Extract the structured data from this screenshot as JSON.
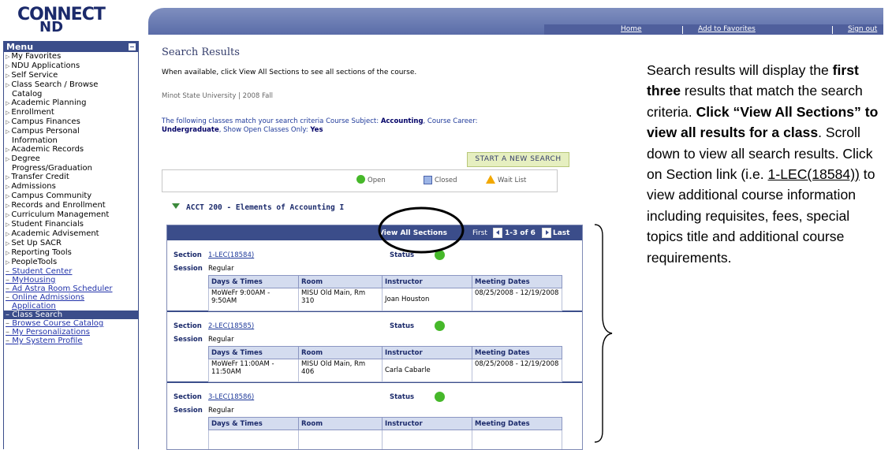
{
  "brand": {
    "logo_text": "CONNECT",
    "logo_sub": "ND"
  },
  "topnav": {
    "home": "Home",
    "favorites": "Add to Favorites",
    "signout": "Sign out"
  },
  "menu": {
    "title": "Menu",
    "items": [
      {
        "label": "My Favorites",
        "type": "folder"
      },
      {
        "label": "NDU Applications",
        "type": "folder"
      },
      {
        "label": "Self Service",
        "type": "folder"
      },
      {
        "label": "Class Search / Browse",
        "type": "folder"
      },
      {
        "label": "Catalog",
        "type": "cont"
      },
      {
        "label": "Academic Planning",
        "type": "folder"
      },
      {
        "label": "Enrollment",
        "type": "folder"
      },
      {
        "label": "Campus Finances",
        "type": "folder"
      },
      {
        "label": "Campus Personal",
        "type": "folder"
      },
      {
        "label": "Information",
        "type": "cont"
      },
      {
        "label": "Academic Records",
        "type": "folder"
      },
      {
        "label": "Degree",
        "type": "folder"
      },
      {
        "label": "Progress/Graduation",
        "type": "cont"
      },
      {
        "label": "Transfer Credit",
        "type": "folder"
      },
      {
        "label": "Admissions",
        "type": "folder"
      },
      {
        "label": "Campus Community",
        "type": "folder"
      },
      {
        "label": "Records and Enrollment",
        "type": "folder"
      },
      {
        "label": "Curriculum Management",
        "type": "folder"
      },
      {
        "label": "Student Financials",
        "type": "folder"
      },
      {
        "label": "Academic Advisement",
        "type": "folder"
      },
      {
        "label": "Set Up SACR",
        "type": "folder"
      },
      {
        "label": "Reporting Tools",
        "type": "folder"
      },
      {
        "label": "PeopleTools",
        "type": "folder"
      },
      {
        "label": "Student Center",
        "type": "link"
      },
      {
        "label": "MyHousing",
        "type": "link"
      },
      {
        "label": "Ad Astra Room Scheduler",
        "type": "link"
      },
      {
        "label": "Online Admissions",
        "type": "link"
      },
      {
        "label": "Application",
        "type": "linkcont"
      },
      {
        "label": "Class Search",
        "type": "active"
      },
      {
        "label": "Browse Course Catalog",
        "type": "link"
      },
      {
        "label": "My Personalizations",
        "type": "link"
      },
      {
        "label": "My System Profile",
        "type": "link"
      }
    ]
  },
  "main": {
    "title": "Search Results",
    "instruction": "When available, click View All Sections to see all sections of the course.",
    "term": "Minot State University | 2008 Fall",
    "criteria_prefix": "The following classes match your search criteria Course Subject:",
    "criteria_subject": "Accounting",
    "criteria_career_label": ", Course Career:",
    "criteria_career": "Undergraduate",
    "criteria_open_label": ", Show Open Classes Only:",
    "criteria_open": "Yes",
    "new_search_button": "START A NEW SEARCH",
    "legend": {
      "open": "Open",
      "closed": "Closed",
      "waitlist": "Wait List"
    },
    "course_title": "ACCT 200 - Elements of Accounting I",
    "grid": {
      "view_all": "View All Sections",
      "first": "First",
      "range": "1-3 of 6",
      "last": "Last"
    },
    "columns": [
      "Days & Times",
      "Room",
      "Instructor",
      "Meeting Dates"
    ],
    "labels": {
      "section": "Section",
      "session": "Session",
      "status": "Status"
    },
    "sections": [
      {
        "section": "1-LEC(18584)",
        "session": "Regular",
        "days": "MoWeFr 9:00AM - 9:50AM",
        "room": "MISU Old Main, Rm 310",
        "instructor": "Joan Houston",
        "dates": "08/25/2008 - 12/19/2008"
      },
      {
        "section": "2-LEC(18585)",
        "session": "Regular",
        "days": "MoWeFr 11:00AM - 11:50AM",
        "room": "MISU Old Main, Rm 406",
        "instructor": "Carla Cabarle",
        "dates": "08/25/2008 - 12/19/2008"
      },
      {
        "section": "3-LEC(18586)",
        "session": "Regular",
        "days": "",
        "room": "",
        "instructor": "",
        "dates": ""
      }
    ]
  },
  "callout": {
    "p1": "Search results will display the ",
    "b1": "first three",
    "p2": " results that match the search criteria. ",
    "b2": "Click “View All Sections” to view all results for a class",
    "p3": ". Scroll down to view all search results. Click on Section link (i.e. ",
    "u1": "1-LEC(18584))",
    "p4": " to view additional course information including requisites, fees, special topics title and additional course requirements."
  },
  "colors": {
    "brand_blue": "#3b4d8a",
    "open_green": "#46b82a",
    "wait_orange": "#f2a800",
    "button_green": "#e6efc0"
  }
}
